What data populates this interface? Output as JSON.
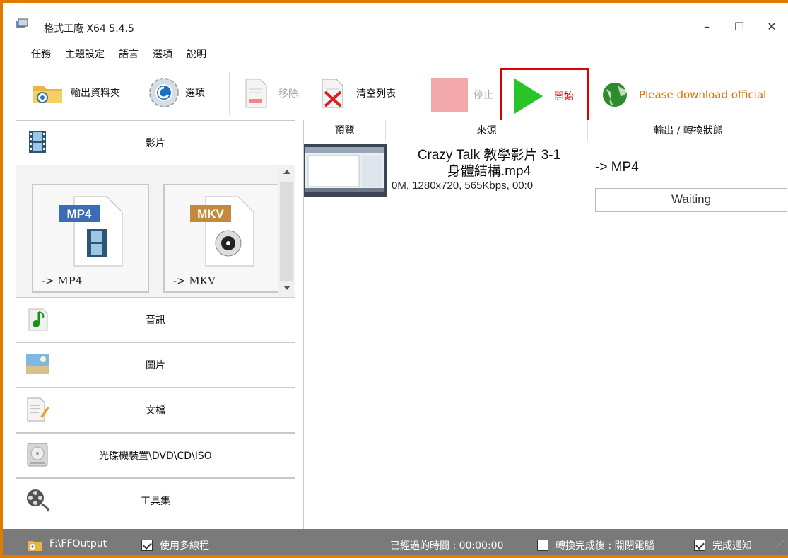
{
  "window": {
    "title": "格式工廠 X64 5.4.5",
    "minimize": "–",
    "maximize": "☐",
    "close": "✕"
  },
  "menu": [
    "任務",
    "主題設定",
    "語言",
    "選項",
    "說明"
  ],
  "toolbar": {
    "output_folder": "輸出資料夾",
    "options": "選項",
    "remove": "移除",
    "clear_list": "清空列表",
    "stop": "停止",
    "start": "開始",
    "download_notice": "Please download official"
  },
  "categories": {
    "video": "影片",
    "audio": "音訊",
    "image": "圖片",
    "document": "文檔",
    "disc": "光碟機裝置\\DVD\\CD\\ISO",
    "tools": "工具集"
  },
  "formats": [
    {
      "badge": "MP4",
      "label": "-> MP4"
    },
    {
      "badge": "MKV",
      "label": "-> MKV"
    }
  ],
  "table": {
    "headers": [
      "預覽",
      "來源",
      "輸出 / 轉換狀態"
    ],
    "rows": [
      {
        "source_name_line1": "Crazy Talk 教學影片 3-1",
        "source_name_line2": "身體結構.mp4",
        "source_info": "0M, 1280x720, 565Kbps, 00:0",
        "output_format": "-> MP4",
        "status": "Waiting"
      }
    ]
  },
  "statusbar": {
    "output_path": "F:\\FFOutput",
    "multithread_label": "使用多線程",
    "elapsed": "已經過的時間 : 00:00:00",
    "after_convert": "轉換完成後 : 關閉電腦",
    "notify": "完成通知"
  },
  "colors": {
    "accent_border": "#e07b00",
    "start_highlight": "#e00000",
    "start_text": "#d40000",
    "download_text": "#e07000"
  }
}
